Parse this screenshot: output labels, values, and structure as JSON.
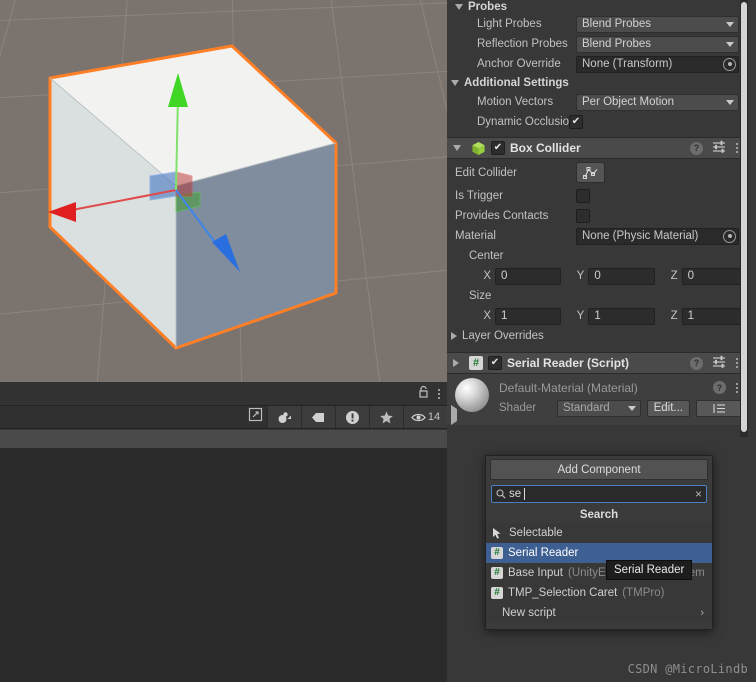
{
  "scene": {
    "name": "scene-view",
    "background_color": "#7b736d",
    "selection_outline_color": "#ff7f27",
    "gizmo": {
      "x_axis_color": "#e03030",
      "y_axis_color": "#3fd626",
      "z_axis_color": "#2a6fe0"
    }
  },
  "lower_panel": {
    "lock_icon": "lock-icon",
    "menu_icon": "kebab-menu-icon",
    "search_placeholder": "",
    "search_value": "",
    "buttons": [
      {
        "icon": "popout-icon",
        "label": ""
      },
      {
        "icon": "gizmo-mode-icon",
        "label": ""
      },
      {
        "icon": "tag-icon",
        "label": ""
      },
      {
        "icon": "error-icon",
        "label": ""
      },
      {
        "icon": "favorite-star-icon",
        "label": ""
      }
    ],
    "visibility": {
      "icon": "eye-icon",
      "count": "14"
    }
  },
  "inspector": {
    "probes": {
      "title": "Probes",
      "expanded": true,
      "rows": [
        {
          "label": "Light Probes",
          "type": "dropdown",
          "value": "Blend Probes"
        },
        {
          "label": "Reflection Probes",
          "type": "dropdown",
          "value": "Blend Probes"
        },
        {
          "label": "Anchor Override",
          "type": "object",
          "value": "None (Transform)"
        }
      ]
    },
    "additional_settings": {
      "title": "Additional Settings",
      "expanded": true,
      "rows": [
        {
          "label": "Motion Vectors",
          "type": "dropdown",
          "value": "Per Object Motion"
        },
        {
          "label": "Dynamic Occlusion",
          "type": "checkbox",
          "checked": true
        }
      ]
    },
    "box_collider": {
      "title": "Box Collider",
      "icon": "green-cube-icon",
      "enabled": true,
      "help_icon": "help-icon",
      "preset_icon": "preset-settings-icon",
      "menu_icon": "kebab-menu-icon",
      "edit_collider": {
        "label": "Edit Collider",
        "button_icon": "edit-collider-icon"
      },
      "is_trigger": {
        "label": "Is Trigger",
        "checked": false
      },
      "provides_contacts": {
        "label": "Provides Contacts",
        "checked": false
      },
      "material": {
        "label": "Material",
        "value": "None (Physic Material)"
      },
      "center": {
        "label": "Center",
        "axes": [
          "X",
          "Y",
          "Z"
        ],
        "values": [
          "0",
          "0",
          "0"
        ]
      },
      "size": {
        "label": "Size",
        "axes": [
          "X",
          "Y",
          "Z"
        ],
        "values": [
          "1",
          "1",
          "1"
        ]
      },
      "layer_overrides": {
        "label": "Layer Overrides",
        "expanded": false
      }
    },
    "serial_reader": {
      "title": "Serial Reader (Script)",
      "icon": "csharp-script-icon",
      "enabled": true,
      "expanded": false,
      "help_icon": "help-icon",
      "preset_icon": "preset-settings-icon",
      "menu_icon": "kebab-menu-icon"
    },
    "material_preview": {
      "title": "Default-Material (Material)",
      "preview_icon": "material-sphere-icon",
      "help_icon": "help-icon",
      "menu_icon": "kebab-menu-icon",
      "shader_label": "Shader",
      "shader_value": "Standard",
      "edit_button": "Edit...",
      "list_button_icon": "shader-list-icon"
    }
  },
  "add_component": {
    "title": "Add Component",
    "search": {
      "icon": "search-icon",
      "value": "se",
      "clear_icon": "clear-x-icon"
    },
    "section_label": "Search",
    "items": [
      {
        "icon": "selectable-cursor-icon",
        "label": "Selectable",
        "namespace": "",
        "selected": false
      },
      {
        "icon": "csharp-script-icon",
        "label": "Serial Reader",
        "namespace": "",
        "selected": true
      },
      {
        "icon": "csharp-script-icon",
        "label": "Base Input",
        "namespace": "(UnityEngine.EventSystem",
        "selected": false
      },
      {
        "icon": "csharp-script-icon",
        "label": "TMP_Selection Caret",
        "namespace": "(TMPro)",
        "selected": false
      }
    ],
    "new_script": {
      "label": "New script",
      "chevron": "›"
    },
    "tooltip": "Serial Reader"
  },
  "watermark": "CSDN @MicroLindb"
}
